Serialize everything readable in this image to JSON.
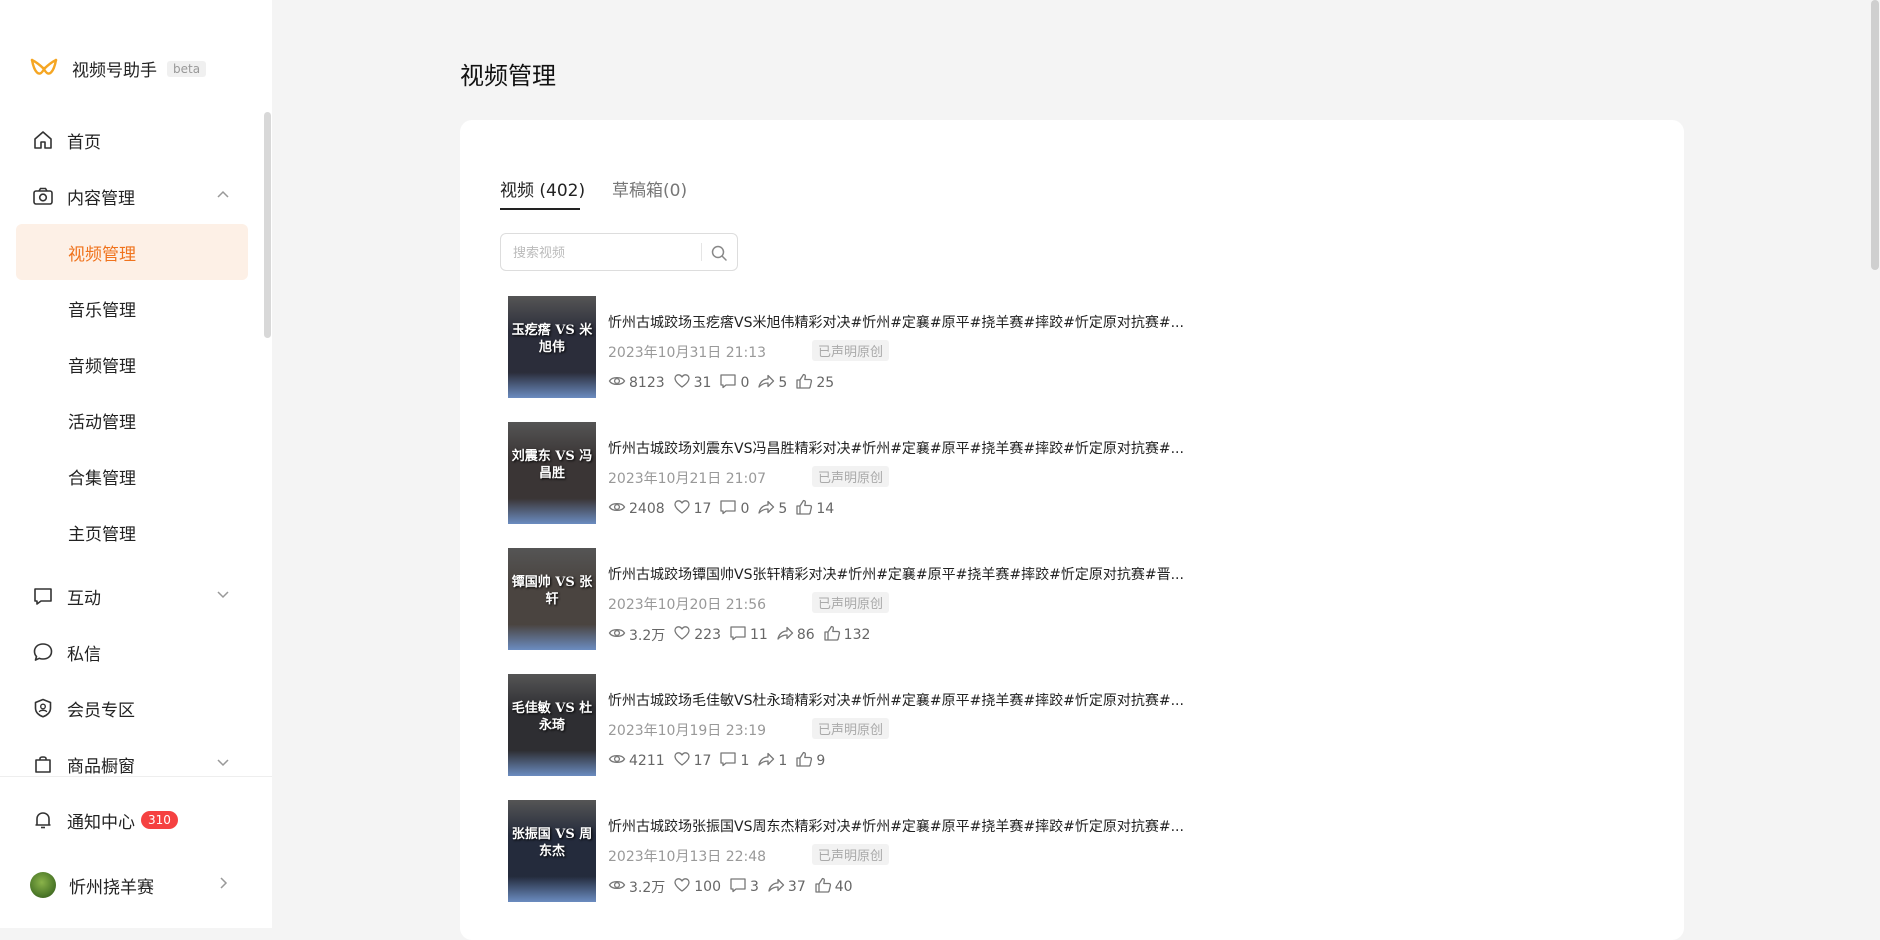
{
  "brand": {
    "name": "视频号助手",
    "beta": "beta"
  },
  "sidebar": {
    "items": [
      {
        "id": "home",
        "label": "首页"
      },
      {
        "id": "content",
        "label": "内容管理"
      },
      {
        "id": "video",
        "label": "视频管理"
      },
      {
        "id": "music",
        "label": "音乐管理"
      },
      {
        "id": "audio",
        "label": "音频管理"
      },
      {
        "id": "activity",
        "label": "活动管理"
      },
      {
        "id": "collection",
        "label": "合集管理"
      },
      {
        "id": "homepage",
        "label": "主页管理"
      },
      {
        "id": "interact",
        "label": "互动"
      },
      {
        "id": "message",
        "label": "私信"
      },
      {
        "id": "member",
        "label": "会员专区"
      },
      {
        "id": "shop",
        "label": "商品橱窗"
      }
    ],
    "notify": {
      "label": "通知中心",
      "count": "310"
    },
    "user": {
      "name": "忻州挠羊赛"
    }
  },
  "page": {
    "title": "视频管理"
  },
  "tabs": [
    {
      "label": "视频 (402)"
    },
    {
      "label": "草稿箱(0)"
    }
  ],
  "search": {
    "placeholder": "搜索视频"
  },
  "videos": [
    {
      "title": "忻州古城跤场玉疙瘩VS米旭伟精彩对决#忻州#定襄#原平#挠羊赛#摔跤#忻定原对抗赛#...",
      "date": "2023年10月31日 21:13",
      "badge": "已声明原创",
      "views": "8123",
      "likes": "31",
      "comments": "0",
      "shares": "5",
      "thumbs": "25",
      "thumb_text": "玉疙瘩 VS 米旭伟",
      "thumb_color": "#2b2d3a"
    },
    {
      "title": "忻州古城跤场刘震东VS冯昌胜精彩对决#忻州#定襄#原平#挠羊赛#摔跤#忻定原对抗赛#...",
      "date": "2023年10月21日 21:07",
      "badge": "已声明原创",
      "views": "2408",
      "likes": "17",
      "comments": "0",
      "shares": "5",
      "thumbs": "14",
      "thumb_text": "刘震东 VS 冯昌胜",
      "thumb_color": "#3a3535"
    },
    {
      "title": "忻州古城跤场镡国帅VS张轩精彩对决#忻州#定襄#原平#挠羊赛#摔跤#忻定原对抗赛#晋...",
      "date": "2023年10月20日 21:56",
      "badge": "已声明原创",
      "views": "3.2万",
      "likes": "223",
      "comments": "11",
      "shares": "86",
      "thumbs": "132",
      "thumb_text": "镡国帅 VS 张轩",
      "thumb_color": "#4a4440"
    },
    {
      "title": "忻州古城跤场毛佳敏VS杜永琦精彩对决#忻州#定襄#原平#挠羊赛#摔跤#忻定原对抗赛#...",
      "date": "2023年10月19日 23:19",
      "badge": "已声明原创",
      "views": "4211",
      "likes": "17",
      "comments": "1",
      "shares": "1",
      "thumbs": "9",
      "thumb_text": "毛佳敏 VS 杜永琦",
      "thumb_color": "#2e2e32"
    },
    {
      "title": "忻州古城跤场张振国VS周东杰精彩对决#忻州#定襄#原平#挠羊赛#摔跤#忻定原对抗赛#...",
      "date": "2023年10月13日 22:48",
      "badge": "已声明原创",
      "views": "3.2万",
      "likes": "100",
      "comments": "3",
      "shares": "37",
      "thumbs": "40",
      "thumb_text": "张振国 VS 周东杰",
      "thumb_color": "#242b3c"
    }
  ]
}
